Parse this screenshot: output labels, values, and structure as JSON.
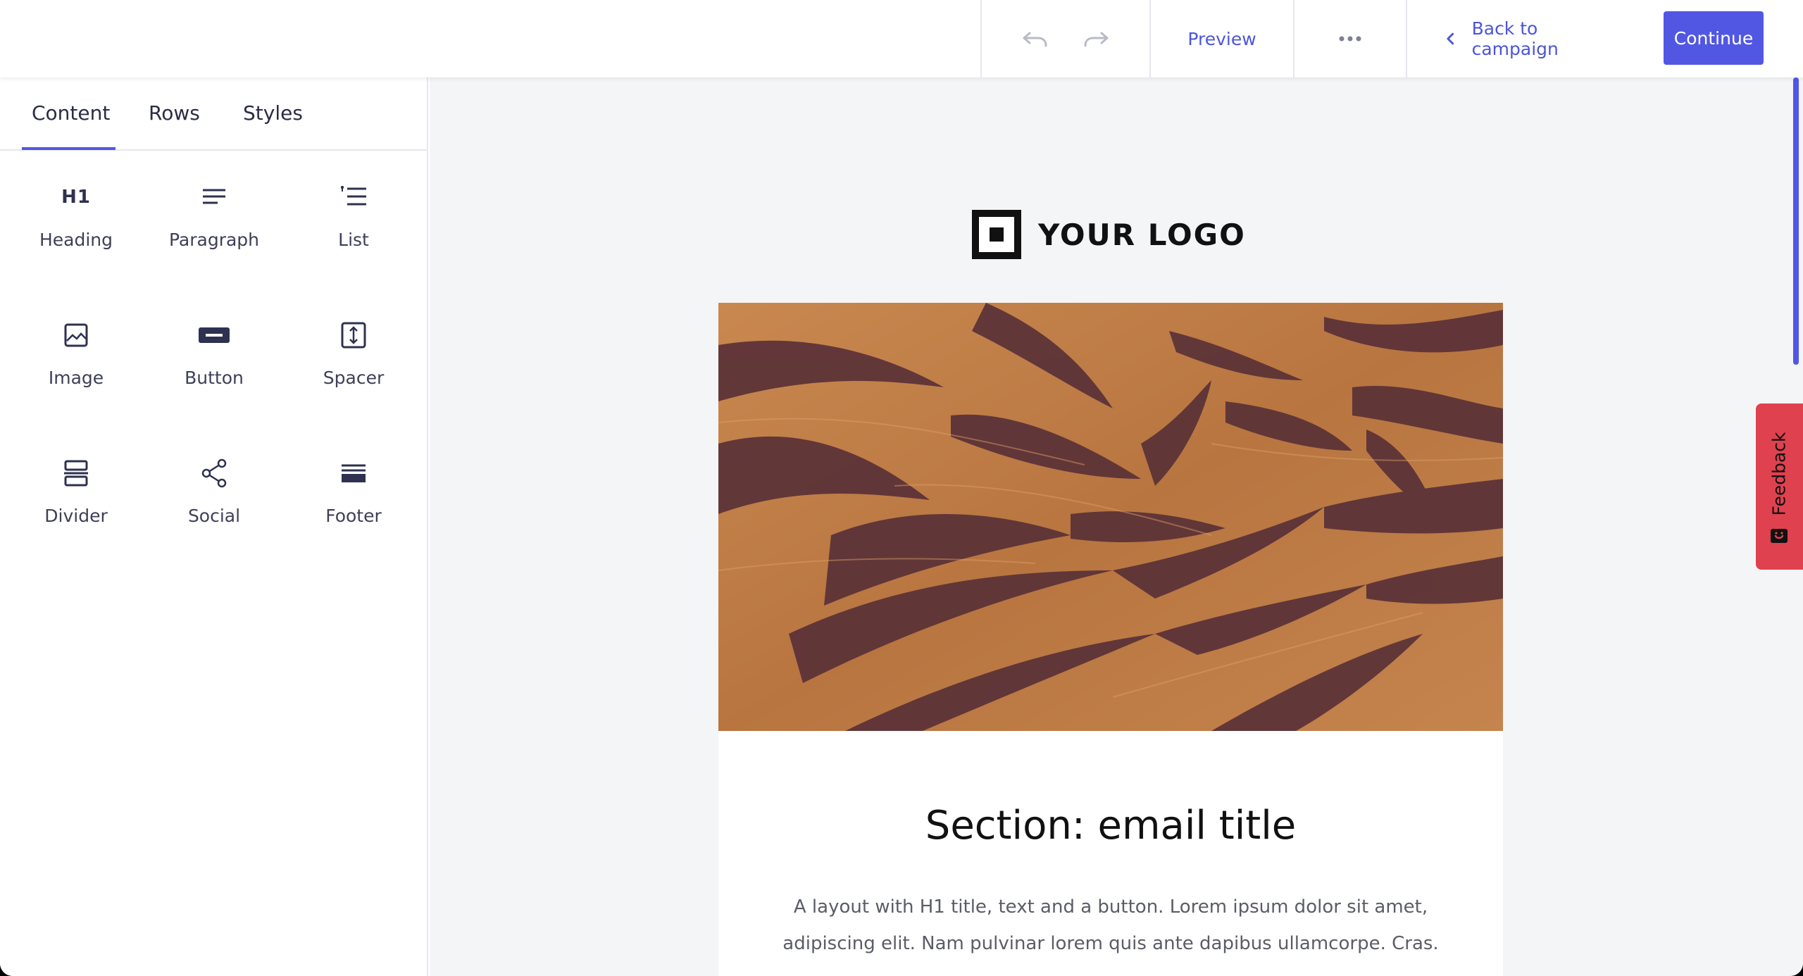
{
  "topbar": {
    "undo_icon": "undo-icon",
    "redo_icon": "redo-icon",
    "preview_label": "Preview",
    "more_icon": "more-horizontal-icon",
    "back_label": "Back to campaign",
    "continue_label": "Continue",
    "accent_color": "#5157e3"
  },
  "sidebar": {
    "tabs": [
      {
        "label": "Content",
        "active": true
      },
      {
        "label": "Rows",
        "active": false
      },
      {
        "label": "Styles",
        "active": false
      }
    ],
    "tiles": [
      {
        "label": "Heading",
        "icon": "heading-icon",
        "icon_text": "H1"
      },
      {
        "label": "Paragraph",
        "icon": "paragraph-icon"
      },
      {
        "label": "List",
        "icon": "list-icon"
      },
      {
        "label": "Image",
        "icon": "image-icon"
      },
      {
        "label": "Button",
        "icon": "button-icon"
      },
      {
        "label": "Spacer",
        "icon": "spacer-icon"
      },
      {
        "label": "Divider",
        "icon": "divider-icon"
      },
      {
        "label": "Social",
        "icon": "share-icon"
      },
      {
        "label": "Footer",
        "icon": "footer-icon"
      }
    ]
  },
  "canvas": {
    "logo_text": "YOUR LOGO",
    "hero_image": "desert-dunes-photo",
    "section_title": "Section: email title",
    "section_body": "A layout with H1 title, text and a button. Lorem ipsum dolor sit amet, adipiscing elit. Nam pulvinar lorem quis ante dapibus ullamcorpe. Cras."
  },
  "feedback": {
    "label": "Feedback",
    "color": "#e0414f"
  }
}
